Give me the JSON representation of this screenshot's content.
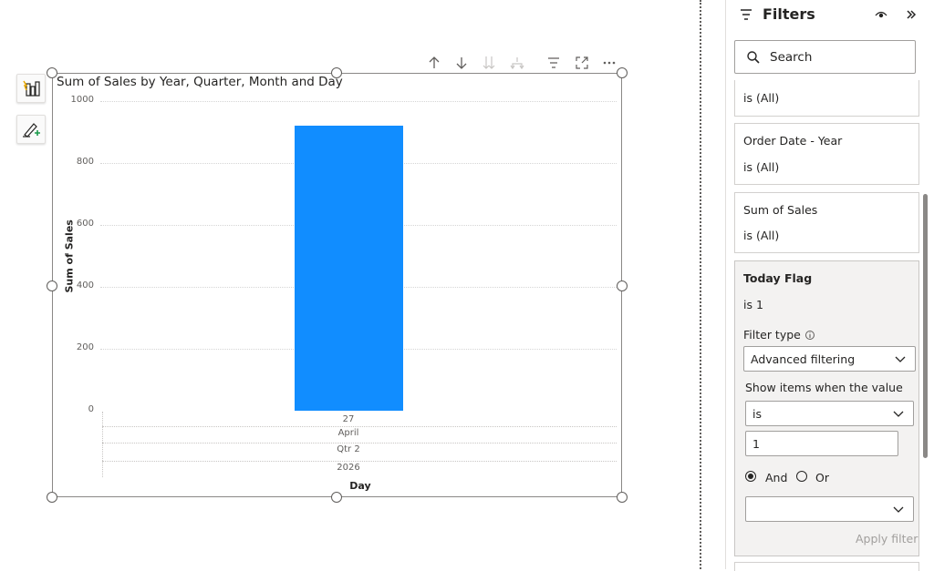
{
  "visual_header": {
    "icons": [
      "arrow-up-icon",
      "arrow-down-icon",
      "double-arrow-down-icon",
      "expand-hierarchy-icon",
      "filter-icon",
      "focus-mode-icon",
      "more-options-icon"
    ]
  },
  "left_toolbar": {
    "icons": [
      "build-visual-icon",
      "format-visual-icon"
    ]
  },
  "chart_data": {
    "type": "bar",
    "title": "Sum of Sales by Year, Quarter, Month and Day",
    "ylabel": "Sum of Sales",
    "xlabel": "Day",
    "ylim": [
      0,
      1000
    ],
    "y_ticks": [
      "1000",
      "800",
      "600",
      "400",
      "200",
      "0"
    ],
    "categories": [
      "27"
    ],
    "category_levels": [
      "April",
      "Qtr 2",
      "2026"
    ],
    "values": [
      920
    ],
    "bar_color": "#118dff",
    "grid": true
  },
  "filters": {
    "title": "Filters",
    "search_placeholder": "Search",
    "cards": [
      {
        "title": "",
        "sub": "is (All)"
      },
      {
        "title": "Order Date - Year",
        "sub": "is (All)"
      },
      {
        "title": "Sum of Sales",
        "sub": "is (All)"
      }
    ],
    "active": {
      "title": "Today Flag",
      "sub": "is 1",
      "filter_type_label": "Filter type",
      "filter_type_value": "Advanced filtering",
      "show_items_label": "Show items when the value",
      "condition_value": "is",
      "input_value": "1",
      "and_label": "And",
      "or_label": "Or",
      "second_condition_value": "",
      "apply_label": "Apply filter"
    }
  }
}
